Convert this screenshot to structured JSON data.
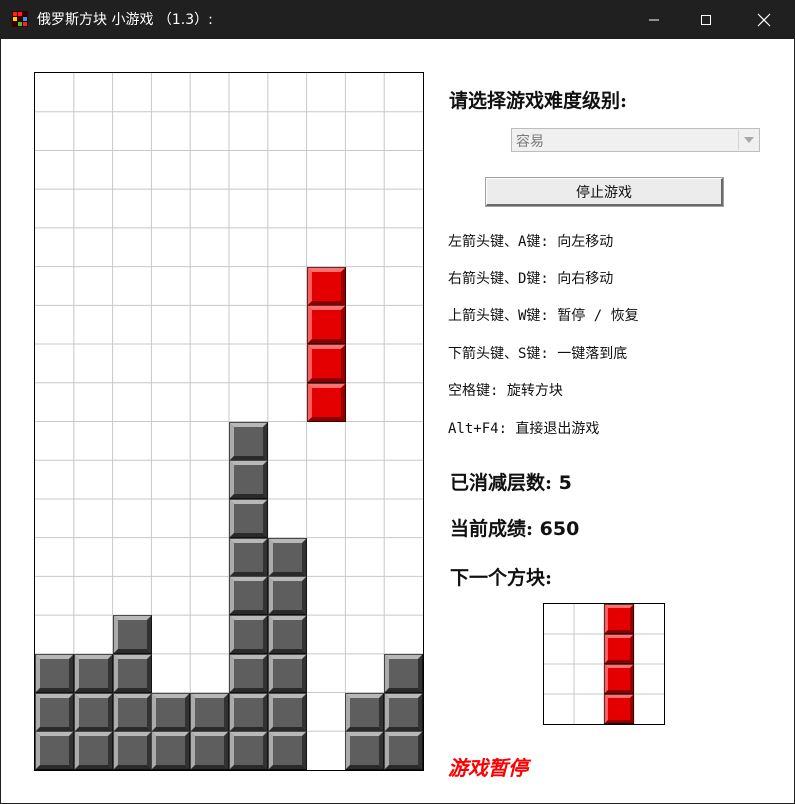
{
  "window": {
    "title": "俄罗斯方块 小游戏 （1.3）:",
    "controls": [
      "minimize",
      "maximize",
      "close"
    ]
  },
  "colors": {
    "grid_line": "#c8c8c8",
    "block_gray": "#5c5c5c",
    "block_red": "#ff0000",
    "status_red": "#ff0000"
  },
  "board": {
    "columns": 10,
    "rows": 18,
    "falling_piece": {
      "shape": "I",
      "color": "red",
      "cells": [
        [
          5,
          7
        ],
        [
          6,
          7
        ],
        [
          7,
          7
        ],
        [
          8,
          7
        ]
      ]
    },
    "settled_cells": [
      [
        9,
        5
      ],
      [
        10,
        5
      ],
      [
        11,
        5
      ],
      [
        12,
        5
      ],
      [
        13,
        5
      ],
      [
        14,
        5
      ],
      [
        15,
        5
      ],
      [
        16,
        5
      ],
      [
        17,
        5
      ],
      [
        12,
        6
      ],
      [
        13,
        6
      ],
      [
        14,
        6
      ],
      [
        15,
        6
      ],
      [
        16,
        6
      ],
      [
        17,
        6
      ],
      [
        14,
        2
      ],
      [
        15,
        2
      ],
      [
        16,
        2
      ],
      [
        17,
        2
      ],
      [
        15,
        0
      ],
      [
        16,
        0
      ],
      [
        17,
        0
      ],
      [
        15,
        1
      ],
      [
        16,
        1
      ],
      [
        17,
        1
      ],
      [
        16,
        3
      ],
      [
        17,
        3
      ],
      [
        16,
        4
      ],
      [
        17,
        4
      ],
      [
        15,
        9
      ],
      [
        16,
        9
      ],
      [
        17,
        9
      ],
      [
        16,
        8
      ],
      [
        17,
        8
      ]
    ]
  },
  "panel": {
    "difficulty_prompt": "请选择游戏难度级别:",
    "difficulty_select": {
      "selected": "容易",
      "disabled": true
    },
    "stop_button_label": "停止游戏",
    "key_help": [
      "左箭头键、A键: 向左移动",
      "右箭头键、D键: 向右移动",
      "上箭头键、W键: 暂停 / 恢复",
      "下箭头键、S键: 一键落到底",
      "空格键: 旋转方块",
      "Alt+F4: 直接退出游戏"
    ],
    "lines_cleared_label": "已消减层数:",
    "lines_cleared": "5",
    "score_label": "当前成绩:",
    "score": "650",
    "next_piece_label": "下一个方块:",
    "next_piece": {
      "shape": "I",
      "color": "red",
      "grid": 4,
      "cells": [
        [
          0,
          2
        ],
        [
          1,
          2
        ],
        [
          2,
          2
        ],
        [
          3,
          2
        ]
      ]
    },
    "status": "游戏暂停"
  }
}
